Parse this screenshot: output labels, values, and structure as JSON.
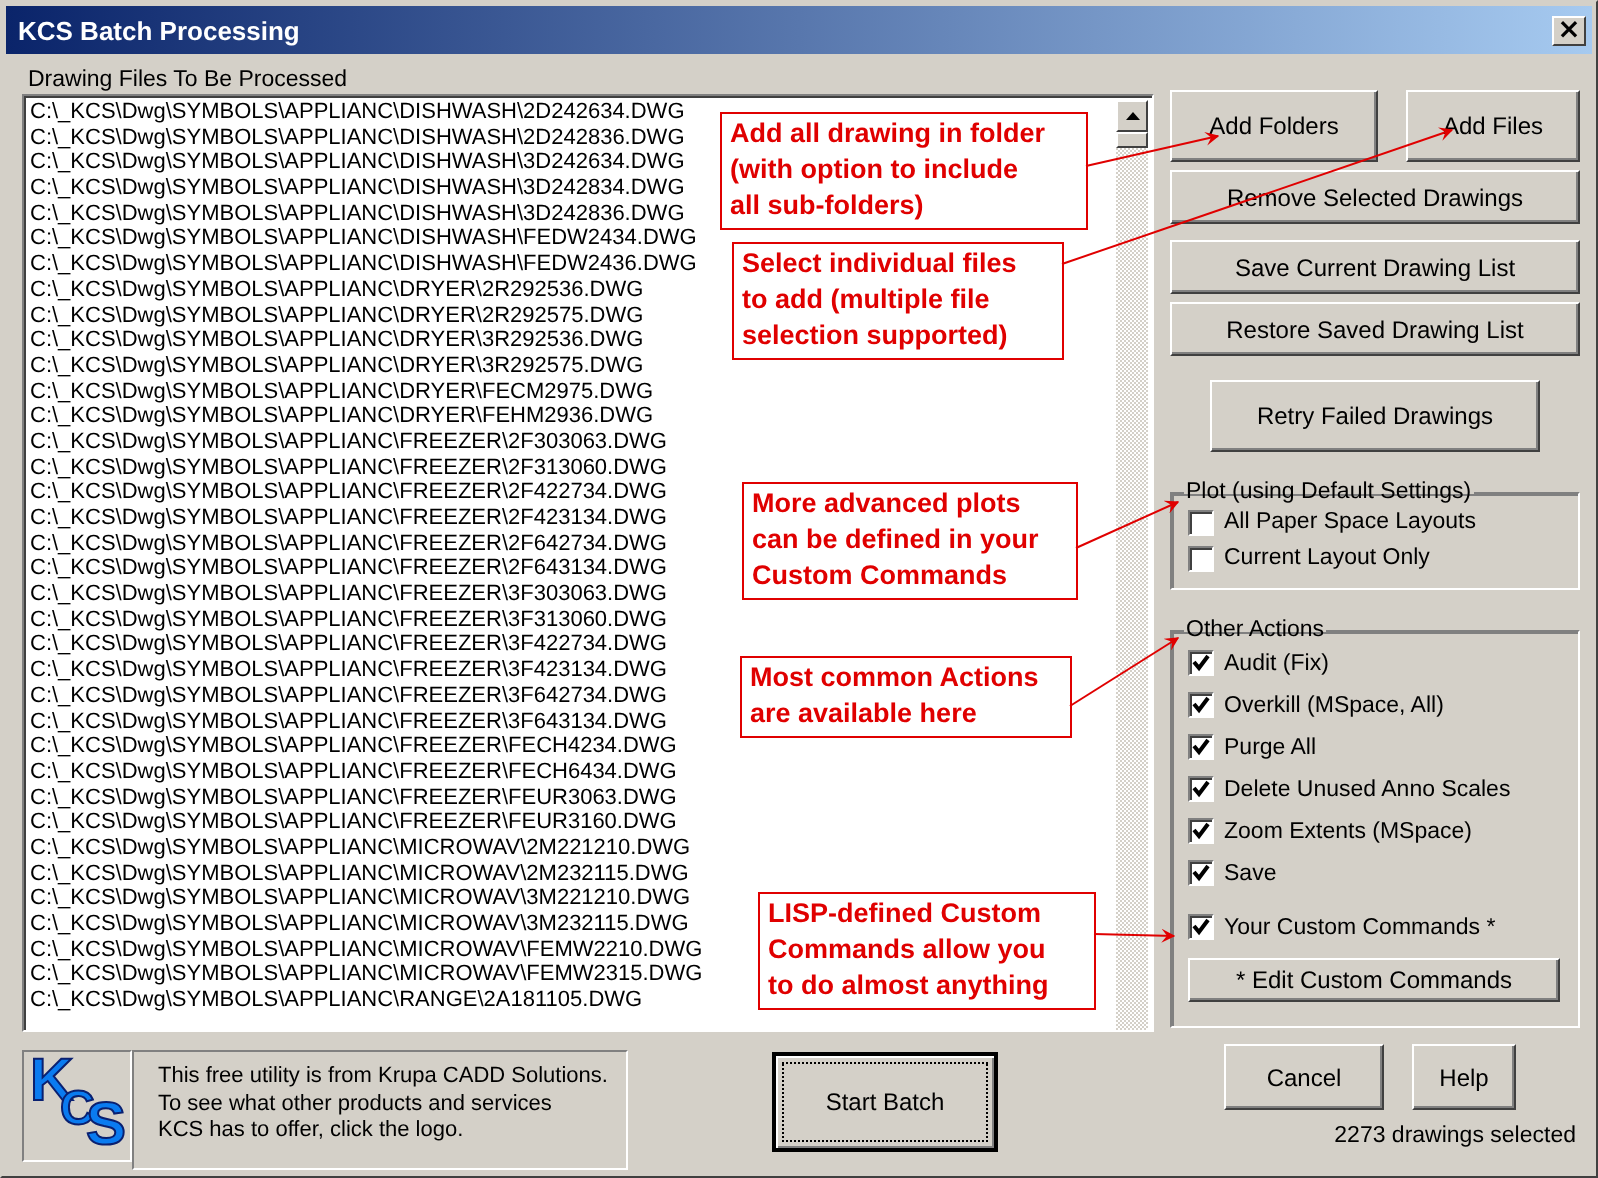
{
  "window": {
    "title": "KCS Batch Processing",
    "close_label": "×"
  },
  "file_list": {
    "label": "Drawing Files To Be Processed",
    "rows": [
      "C:\\_KCS\\Dwg\\SYMBOLS\\APPLIANC\\DISHWASH\\2D242634.DWG",
      "C:\\_KCS\\Dwg\\SYMBOLS\\APPLIANC\\DISHWASH\\2D242836.DWG",
      "C:\\_KCS\\Dwg\\SYMBOLS\\APPLIANC\\DISHWASH\\3D242634.DWG",
      "C:\\_KCS\\Dwg\\SYMBOLS\\APPLIANC\\DISHWASH\\3D242834.DWG",
      "C:\\_KCS\\Dwg\\SYMBOLS\\APPLIANC\\DISHWASH\\3D242836.DWG",
      "C:\\_KCS\\Dwg\\SYMBOLS\\APPLIANC\\DISHWASH\\FEDW2434.DWG",
      "C:\\_KCS\\Dwg\\SYMBOLS\\APPLIANC\\DISHWASH\\FEDW2436.DWG",
      "C:\\_KCS\\Dwg\\SYMBOLS\\APPLIANC\\DRYER\\2R292536.DWG",
      "C:\\_KCS\\Dwg\\SYMBOLS\\APPLIANC\\DRYER\\2R292575.DWG",
      "C:\\_KCS\\Dwg\\SYMBOLS\\APPLIANC\\DRYER\\3R292536.DWG",
      "C:\\_KCS\\Dwg\\SYMBOLS\\APPLIANC\\DRYER\\3R292575.DWG",
      "C:\\_KCS\\Dwg\\SYMBOLS\\APPLIANC\\DRYER\\FECM2975.DWG",
      "C:\\_KCS\\Dwg\\SYMBOLS\\APPLIANC\\DRYER\\FEHM2936.DWG",
      "C:\\_KCS\\Dwg\\SYMBOLS\\APPLIANC\\FREEZER\\2F303063.DWG",
      "C:\\_KCS\\Dwg\\SYMBOLS\\APPLIANC\\FREEZER\\2F313060.DWG",
      "C:\\_KCS\\Dwg\\SYMBOLS\\APPLIANC\\FREEZER\\2F422734.DWG",
      "C:\\_KCS\\Dwg\\SYMBOLS\\APPLIANC\\FREEZER\\2F423134.DWG",
      "C:\\_KCS\\Dwg\\SYMBOLS\\APPLIANC\\FREEZER\\2F642734.DWG",
      "C:\\_KCS\\Dwg\\SYMBOLS\\APPLIANC\\FREEZER\\2F643134.DWG",
      "C:\\_KCS\\Dwg\\SYMBOLS\\APPLIANC\\FREEZER\\3F303063.DWG",
      "C:\\_KCS\\Dwg\\SYMBOLS\\APPLIANC\\FREEZER\\3F313060.DWG",
      "C:\\_KCS\\Dwg\\SYMBOLS\\APPLIANC\\FREEZER\\3F422734.DWG",
      "C:\\_KCS\\Dwg\\SYMBOLS\\APPLIANC\\FREEZER\\3F423134.DWG",
      "C:\\_KCS\\Dwg\\SYMBOLS\\APPLIANC\\FREEZER\\3F642734.DWG",
      "C:\\_KCS\\Dwg\\SYMBOLS\\APPLIANC\\FREEZER\\3F643134.DWG",
      "C:\\_KCS\\Dwg\\SYMBOLS\\APPLIANC\\FREEZER\\FECH4234.DWG",
      "C:\\_KCS\\Dwg\\SYMBOLS\\APPLIANC\\FREEZER\\FECH6434.DWG",
      "C:\\_KCS\\Dwg\\SYMBOLS\\APPLIANC\\FREEZER\\FEUR3063.DWG",
      "C:\\_KCS\\Dwg\\SYMBOLS\\APPLIANC\\FREEZER\\FEUR3160.DWG",
      "C:\\_KCS\\Dwg\\SYMBOLS\\APPLIANC\\MICROWAV\\2M221210.DWG",
      "C:\\_KCS\\Dwg\\SYMBOLS\\APPLIANC\\MICROWAV\\2M232115.DWG",
      "C:\\_KCS\\Dwg\\SYMBOLS\\APPLIANC\\MICROWAV\\3M221210.DWG",
      "C:\\_KCS\\Dwg\\SYMBOLS\\APPLIANC\\MICROWAV\\3M232115.DWG",
      "C:\\_KCS\\Dwg\\SYMBOLS\\APPLIANC\\MICROWAV\\FEMW2210.DWG",
      "C:\\_KCS\\Dwg\\SYMBOLS\\APPLIANC\\MICROWAV\\FEMW2315.DWG",
      "C:\\_KCS\\Dwg\\SYMBOLS\\APPLIANC\\RANGE\\2A181105.DWG"
    ]
  },
  "callouts": [
    {
      "lines": [
        "Add all drawing in folder",
        "(with option to include",
        "all sub-folders)"
      ]
    },
    {
      "lines": [
        "Select individual files",
        "to add (multiple file",
        "selection supported)"
      ]
    },
    {
      "lines": [
        "More advanced plots",
        "can be defined in your",
        "Custom Commands"
      ]
    },
    {
      "lines": [
        "Most common Actions",
        "are available here"
      ]
    },
    {
      "lines": [
        "LISP-defined Custom",
        "Commands allow you",
        "to do almost anything"
      ]
    }
  ],
  "buttons": {
    "add_folders": "Add Folders",
    "add_files": "Add Files",
    "remove": "Remove Selected Drawings",
    "save_list": "Save Current Drawing List",
    "restore_list": "Restore Saved Drawing List",
    "retry": "Retry Failed Drawings"
  },
  "plot_group": {
    "title": "Plot (using Default Settings)",
    "options": [
      {
        "label": "All Paper Space Layouts",
        "checked": false
      },
      {
        "label": "Current Layout Only",
        "checked": false
      }
    ]
  },
  "actions_group": {
    "title": "Other Actions",
    "options": [
      {
        "label": "Audit (Fix)",
        "checked": true
      },
      {
        "label": "Overkill (MSpace, All)",
        "checked": true
      },
      {
        "label": "Purge All",
        "checked": true
      },
      {
        "label": "Delete Unused Anno Scales",
        "checked": true
      },
      {
        "label": "Zoom Extents (MSpace)",
        "checked": true
      },
      {
        "label": "Save",
        "checked": true
      },
      {
        "label": "Your Custom Commands *",
        "checked": true
      }
    ],
    "edit_button": "* Edit Custom Commands"
  },
  "footer": {
    "logo": [
      "K",
      "C",
      "S"
    ],
    "info": [
      "This free utility is from Krupa CADD Solutions.",
      "To see what other products and services",
      "KCS has to offer, click the logo."
    ],
    "start": "Start Batch",
    "cancel": "Cancel",
    "help": "Help",
    "status": "2273 drawings selected"
  }
}
